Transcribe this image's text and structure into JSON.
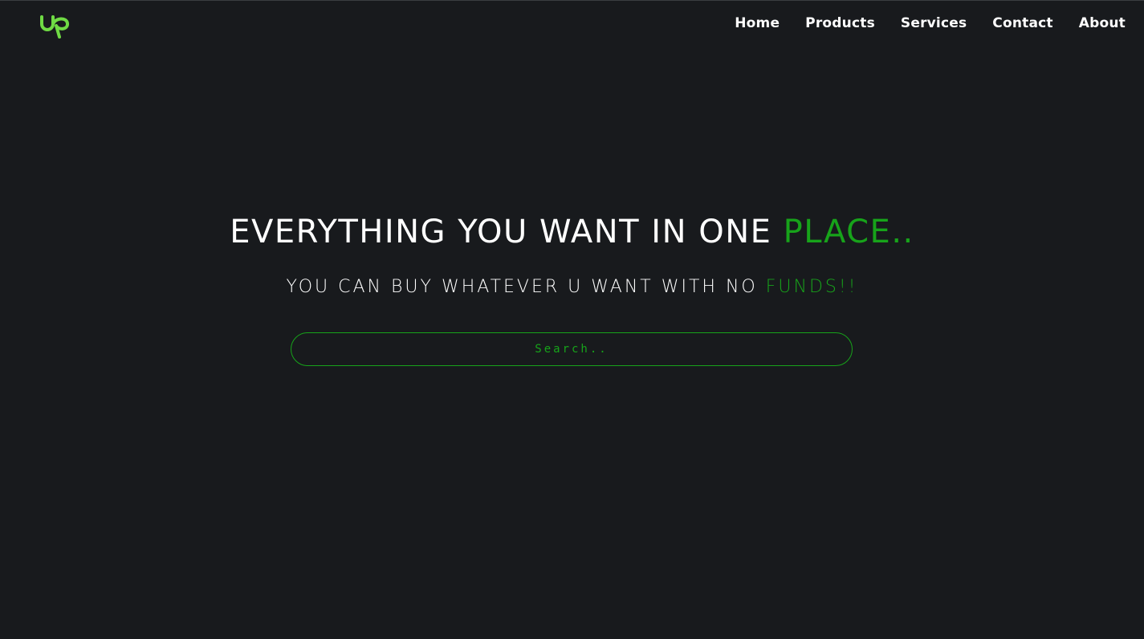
{
  "brand": {
    "logo_icon": "upwork-up-logo-icon",
    "logo_color": "#6fda44"
  },
  "nav": {
    "items": [
      {
        "label": "Home"
      },
      {
        "label": "Products"
      },
      {
        "label": "Services"
      },
      {
        "label": "Contact"
      },
      {
        "label": "About"
      }
    ]
  },
  "hero": {
    "title_main": "EVERYTHING YOU WANT IN ONE ",
    "title_accent": "PLACE..",
    "subtitle_main": "YOU CAN BUY WHATEVER U WANT WITH NO ",
    "subtitle_accent": "FUNDS!!"
  },
  "search": {
    "placeholder": "Search..",
    "value": ""
  },
  "colors": {
    "background": "#181a1d",
    "accent": "#17a31a",
    "text": "#ffffff"
  }
}
